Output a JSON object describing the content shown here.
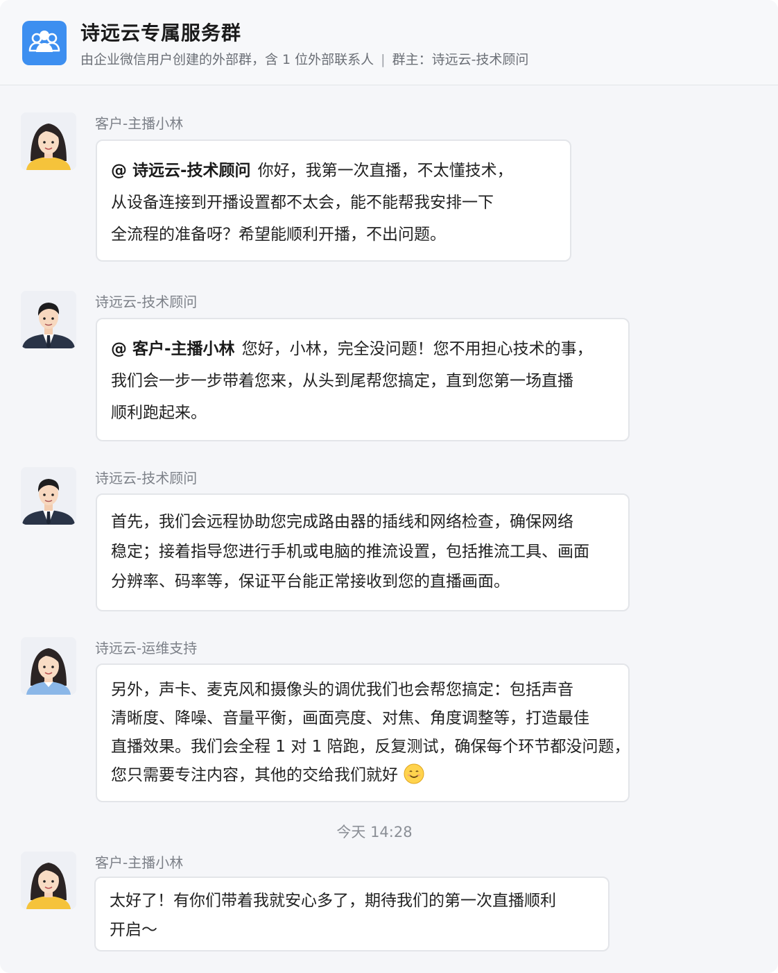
{
  "header": {
    "title": "诗远云专属服务群",
    "subtitle_main": "由企业微信用户创建的外部群，含 1 位外部联系人",
    "subtitle_sep": "|",
    "subtitle_owner": "群主：诗远云-技术顾问",
    "icon": "group-icon"
  },
  "messages": [
    {
      "sender": "客户-主播小林",
      "avatar": "female-yellow-avatar",
      "mention": "@ 诗远云-技术顾问",
      "lines": [
        "你好，我第一次直播，不太懂技术，",
        "从设备连接到开播设置都不太会，能不能帮我安排一下",
        "全流程的准备呀？希望能顺利开播，不出问题。"
      ]
    },
    {
      "sender": "诗远云-技术顾问",
      "avatar": "male-suit-avatar",
      "mention": "@ 客户-主播小林",
      "lines": [
        "您好，小林，完全没问题！您不用担心技术的事，",
        "我们会一步一步带着您来，从头到尾帮您搞定，直到您第一场直播",
        "顺利跑起来。"
      ]
    },
    {
      "sender": "诗远云-技术顾问",
      "avatar": "male-suit-avatar",
      "lines": [
        "首先，我们会远程协助您完成路由器的插线和网络检查，确保网络",
        "稳定；接着指导您进行手机或电脑的推流设置，包括推流工具、画面",
        "分辨率、码率等，保证平台能正常接收到您的直播画面。"
      ]
    },
    {
      "sender": "诗远云-运维支持",
      "avatar": "female-blue-avatar",
      "lines": [
        "另外，声卡、麦克风和摄像头的调优我们也会帮您搞定：包括声音",
        "清晰度、降噪、音量平衡，画面亮度、对焦、角度调整等，打造最佳",
        "直播效果。我们会全程 1 对 1 陪跑，反复测试，确保每个环节都没问题，",
        "您只需要专注内容，其他的交给我们就好"
      ],
      "emoji": "smiling-face-emoji"
    },
    {
      "sender": "客户-主播小林",
      "avatar": "female-yellow-avatar",
      "lines": [
        "太好了！有你们带着我就安心多了，期待我们的第一次直播顺利",
        "开启～"
      ]
    }
  ],
  "time_divider": "今天 14:28"
}
